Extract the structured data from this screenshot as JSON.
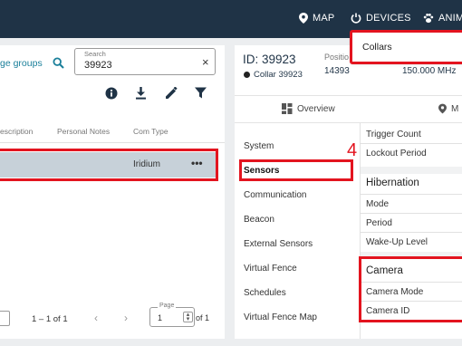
{
  "nav": {
    "map_label": "MAP",
    "devices_label": "DEVICES",
    "animals_label": "ANIM"
  },
  "dropdown": {
    "collars_label": "Collars"
  },
  "left": {
    "groups_label": "ge groups",
    "search": {
      "label": "Search",
      "value": "39923"
    },
    "columns": [
      "escription",
      "Personal Notes",
      "Com Type"
    ],
    "row": {
      "com_type": "Iridium",
      "more": "•••"
    },
    "pagination": {
      "range": "1 – 1 of 1",
      "page_label": "Page",
      "page_value": "1",
      "of_label": "of 1"
    }
  },
  "right": {
    "id_title": "ID: 39923",
    "collar_name": "Collar 39923",
    "position_label": "Positio",
    "position_value": "14393",
    "frequency": "150.000 MHz",
    "tabs": {
      "overview": "Overview",
      "map": "M"
    },
    "step_badge": "4",
    "menu": [
      "System",
      "Sensors",
      "Communication",
      "Beacon",
      "External Sensors",
      "Virtual Fence",
      "Schedules",
      "Virtual Fence Map"
    ],
    "fields_top": [
      "Trigger Count",
      "Lockout Period"
    ],
    "hibernation": {
      "title": "Hibernation",
      "fields": [
        "Mode",
        "Period",
        "Wake-Up Level"
      ]
    },
    "camera": {
      "title": "Camera",
      "fields": [
        "Camera Mode",
        "Camera ID"
      ]
    }
  },
  "colors": {
    "header": "#1f3346",
    "accent": "#1a7f9a",
    "highlight": "#e3141f",
    "selected_row": "#c7d1d9"
  }
}
